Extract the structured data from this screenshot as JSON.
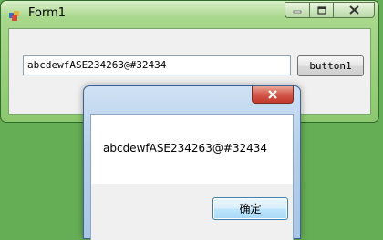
{
  "form": {
    "title": "Form1",
    "icon": "app-window-icon",
    "caption_buttons": [
      "minimize-icon",
      "maximize-icon",
      "close-icon"
    ],
    "textbox_value": "abcdewfASE234263@#32434",
    "button_label": "button1"
  },
  "message_box": {
    "text": "abcdewfASE234263@#32434",
    "ok_label": "确定",
    "close_icon": "close-icon"
  },
  "colors": {
    "desktop": "#66ae55",
    "window_frame": "#8cc86f",
    "dialog_frame": "#b6cfea",
    "dialog_close": "#c23a2b",
    "ok_button_border": "#3c7fb1"
  }
}
